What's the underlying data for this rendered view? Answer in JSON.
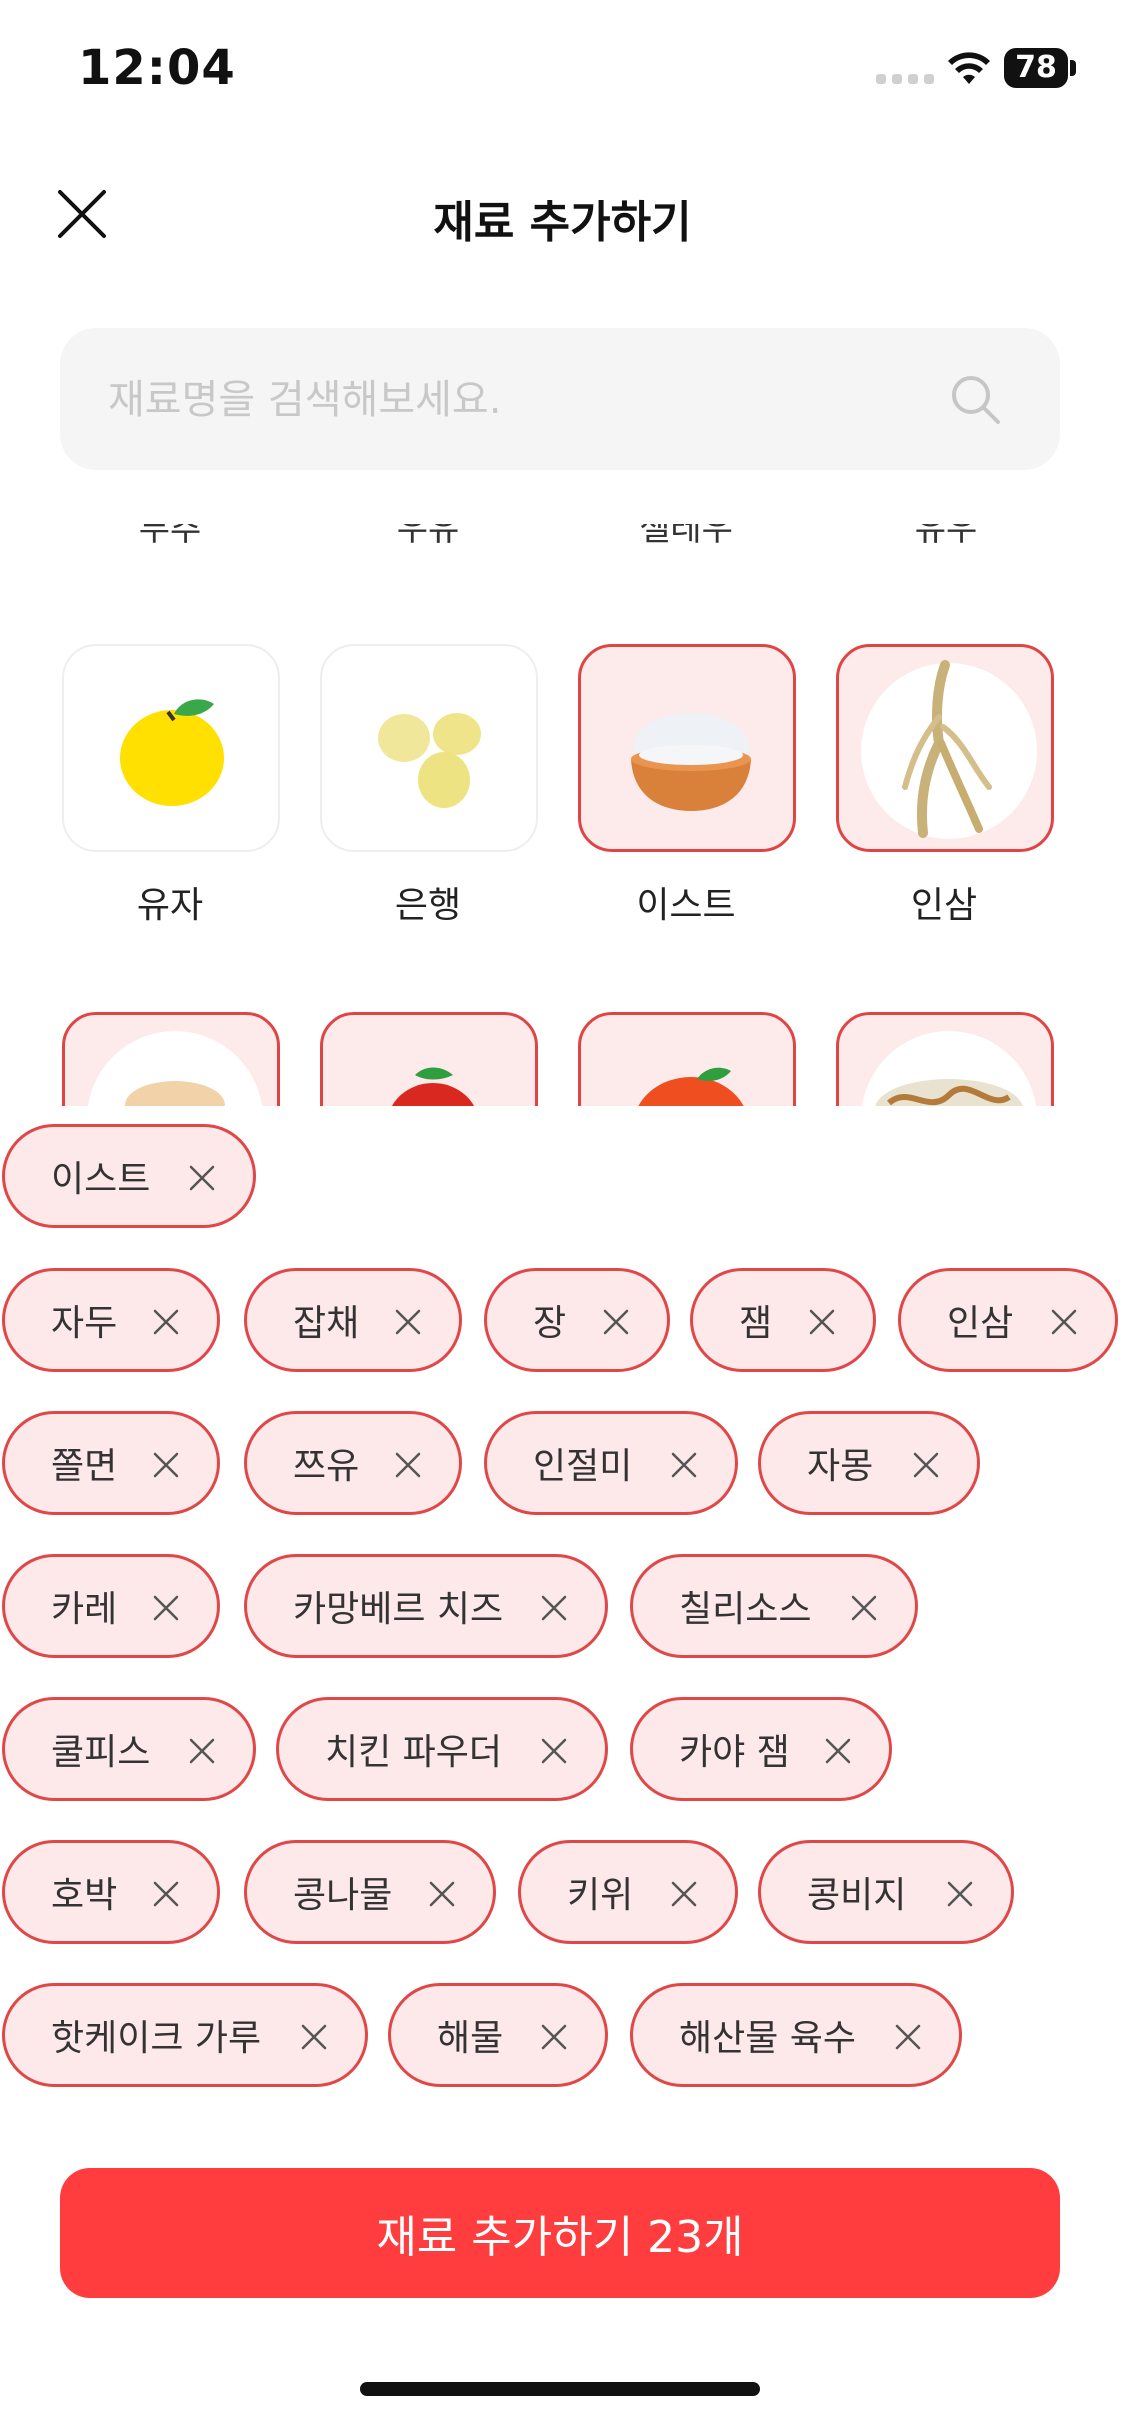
{
  "status": {
    "time": "12:04",
    "battery": "78"
  },
  "header": {
    "title": "재료 추가하기"
  },
  "search": {
    "placeholder": "재료명을 검색해보세요."
  },
  "grid": {
    "partial_labels": [
      "부추",
      "우유",
      "젤레우",
      "유우"
    ],
    "row1": [
      {
        "label": "유자",
        "selected": false,
        "icon": "yuzu-icon"
      },
      {
        "label": "은행",
        "selected": false,
        "icon": "ginkgo-icon"
      },
      {
        "label": "이스트",
        "selected": true,
        "icon": "yeast-bowl-icon"
      },
      {
        "label": "인삼",
        "selected": true,
        "icon": "ginseng-icon"
      }
    ],
    "row2_icons": [
      "flour-icon",
      "tomato-icon",
      "orange-icon",
      "noodles-icon"
    ]
  },
  "chips": [
    "이스트",
    "자두",
    "잡채",
    "장",
    "잼",
    "인삼",
    "쫄면",
    "쯔유",
    "인절미",
    "자몽",
    "카레",
    "카망베르 치즈",
    "칠리소스",
    "쿨피스",
    "치킨 파우더",
    "카야 잼",
    "호박",
    "콩나물",
    "키위",
    "콩비지",
    "핫케이크 가루",
    "해물",
    "해산물 육수"
  ],
  "cta": {
    "label": "재료 추가하기 23개"
  },
  "colors": {
    "accent": "#ff3d3f",
    "chip_border": "#e04848",
    "chip_bg": "#fde8ea"
  }
}
